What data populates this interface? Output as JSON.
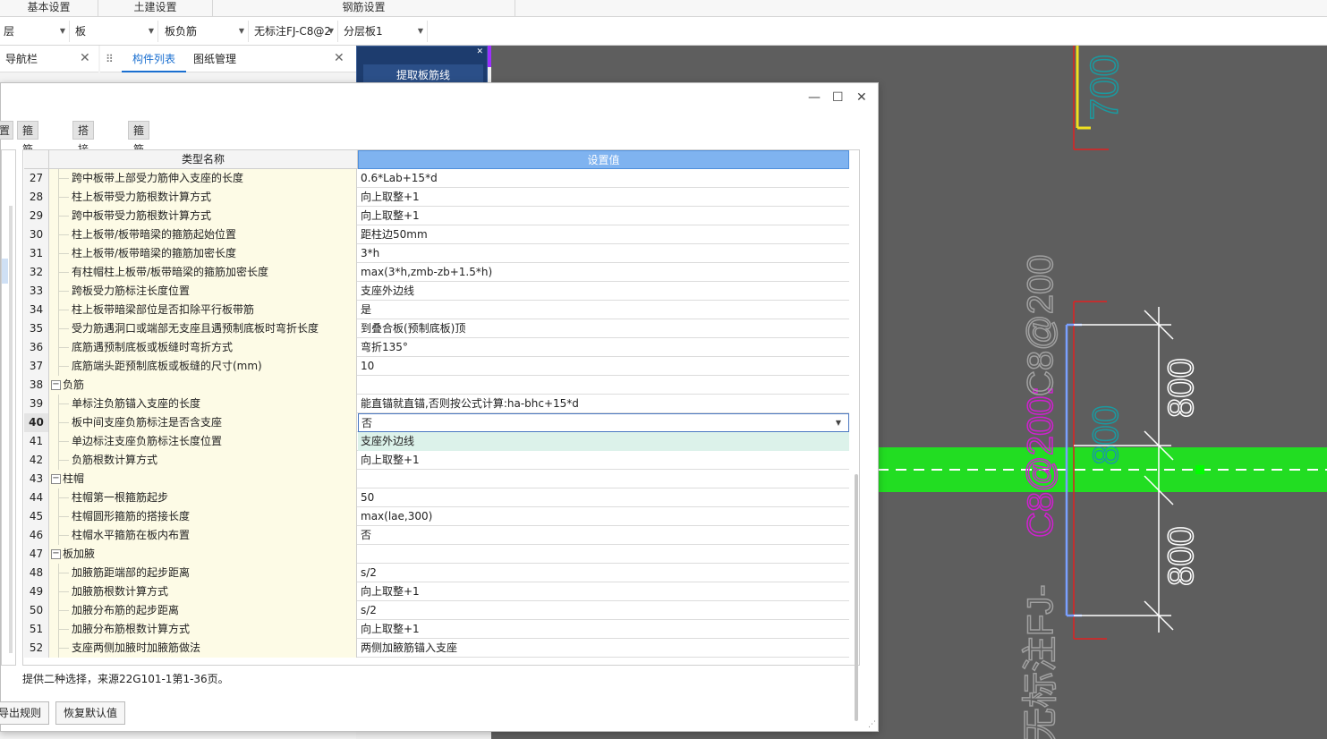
{
  "ribbon": {
    "tabs": [
      "基本设置",
      "土建设置",
      "钢筋设置"
    ]
  },
  "toolbar": {
    "combos": [
      {
        "value": "层"
      },
      {
        "value": "板"
      },
      {
        "value": "板负筋"
      },
      {
        "value": "无标注FJ-C8@2"
      },
      {
        "value": "分层板1"
      }
    ]
  },
  "panels": {
    "nav_tab": "导航栏",
    "component_tab": "构件列表",
    "drawing_tab": "图纸管理",
    "extract_button": "提取板筋线"
  },
  "dialog": {
    "tabs": [
      "置",
      "箍筋设置",
      "搭接设置",
      "箍筋公式"
    ],
    "columns": {
      "name": "类型名称",
      "value": "设置值"
    },
    "rows": [
      {
        "n": "27",
        "name": "跨中板带上部受力筋伸入支座的长度",
        "value": "0.6*Lab+15*d"
      },
      {
        "n": "28",
        "name": "柱上板带受力筋根数计算方式",
        "value": "向上取整+1"
      },
      {
        "n": "29",
        "name": "跨中板带受力筋根数计算方式",
        "value": "向上取整+1"
      },
      {
        "n": "30",
        "name": "柱上板带/板带暗梁的箍筋起始位置",
        "value": "距柱边50mm"
      },
      {
        "n": "31",
        "name": "柱上板带/板带暗梁的箍筋加密长度",
        "value": "3*h"
      },
      {
        "n": "32",
        "name": "有柱帽柱上板带/板带暗梁的箍筋加密长度",
        "value": "max(3*h,zmb-zb+1.5*h)"
      },
      {
        "n": "33",
        "name": "跨板受力筋标注长度位置",
        "value": "支座外边线"
      },
      {
        "n": "34",
        "name": "柱上板带暗梁部位是否扣除平行板带筋",
        "value": "是"
      },
      {
        "n": "35",
        "name": "受力筋遇洞口或端部无支座且遇预制底板时弯折长度",
        "value": "到叠合板(预制底板)顶"
      },
      {
        "n": "36",
        "name": "底筋遇预制底板或板缝时弯折方式",
        "value": "弯折135°"
      },
      {
        "n": "37",
        "name": "底筋端头距预制底板或板缝的尺寸(mm)",
        "value": "10"
      },
      {
        "n": "38",
        "name": "负筋",
        "value": "",
        "group": true
      },
      {
        "n": "39",
        "name": "单标注负筋锚入支座的长度",
        "value": "能直锚就直锚,否则按公式计算:ha-bhc+15*d"
      },
      {
        "n": "40",
        "name": "板中间支座负筋标注是否含支座",
        "value": "否",
        "editing": true
      },
      {
        "n": "41",
        "name": "单边标注支座负筋标注长度位置",
        "value": "支座外边线",
        "highlight": true
      },
      {
        "n": "42",
        "name": "负筋根数计算方式",
        "value": "向上取整+1"
      },
      {
        "n": "43",
        "name": "柱帽",
        "value": "",
        "group": true
      },
      {
        "n": "44",
        "name": "柱帽第一根箍筋起步",
        "value": "50"
      },
      {
        "n": "45",
        "name": "柱帽圆形箍筋的搭接长度",
        "value": "max(lae,300)"
      },
      {
        "n": "46",
        "name": "柱帽水平箍筋在板内布置",
        "value": "否"
      },
      {
        "n": "47",
        "name": "板加腋",
        "value": "",
        "group": true
      },
      {
        "n": "48",
        "name": "加腋筋距端部的起步距离",
        "value": "s/2"
      },
      {
        "n": "49",
        "name": "加腋筋根数计算方式",
        "value": "向上取整+1"
      },
      {
        "n": "50",
        "name": "加腋分布筋的起步距离",
        "value": "s/2"
      },
      {
        "n": "51",
        "name": "加腋分布筋根数计算方式",
        "value": "向上取整+1"
      },
      {
        "n": "52",
        "name": "支座两侧加腋时加腋筋做法",
        "value": "两侧加腋筋锚入支座"
      }
    ],
    "description": "提供二种选择，来源22G101-1第1-36页。",
    "export_button": "导出规则",
    "restore_button": "恢复默认值"
  },
  "canvas": {
    "dim_top": "700",
    "dim_mid_cyan": "800",
    "dim_mid_white": "800",
    "dim_low_white": "800",
    "label_prefix": "无标注FJ-",
    "label_magenta": "C8@200:",
    "label_suffix": "C8@200",
    "colors": {
      "background": "#5e5e5e",
      "slab": "#22dd22",
      "cyan": "#1a9aa0",
      "magenta": "#d020d0",
      "red": "#e02020",
      "yellow": "#f0e020"
    }
  }
}
